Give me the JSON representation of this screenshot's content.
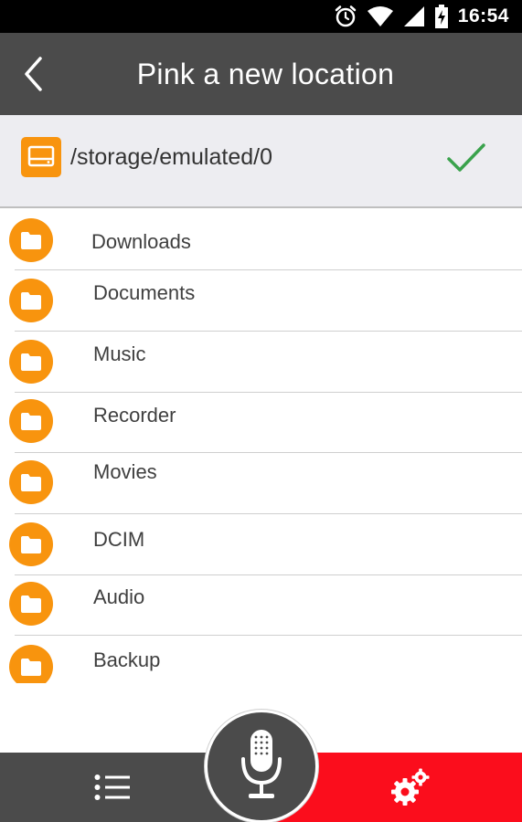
{
  "status_bar": {
    "time": "16:54",
    "icons": [
      "alarm-icon",
      "wifi-icon",
      "signal-icon",
      "battery-charging-icon"
    ]
  },
  "header": {
    "title": "Pink a new location",
    "back_icon": "chevron-left-icon"
  },
  "path_bar": {
    "path": "/storage/emulated/0",
    "storage_icon": "storage-drive-icon",
    "confirm_icon": "checkmark-icon"
  },
  "folders": [
    {
      "label": "Downloads"
    },
    {
      "label": "Documents"
    },
    {
      "label": "Music"
    },
    {
      "label": "Recorder"
    },
    {
      "label": "Movies"
    },
    {
      "label": "DCIM"
    },
    {
      "label": "Audio"
    },
    {
      "label": "Backup"
    }
  ],
  "bottom_bar": {
    "left_icon": "list-icon",
    "center_icon": "microphone-icon",
    "right_icon": "settings-gears-icon"
  },
  "colors": {
    "header_bg": "#4b4b4b",
    "status_bg": "#000000",
    "path_bar_bg": "#ededf1",
    "folder_orange": "#f8940e",
    "confirm_green": "#3aa24c",
    "settings_red": "#fb0d1c"
  }
}
